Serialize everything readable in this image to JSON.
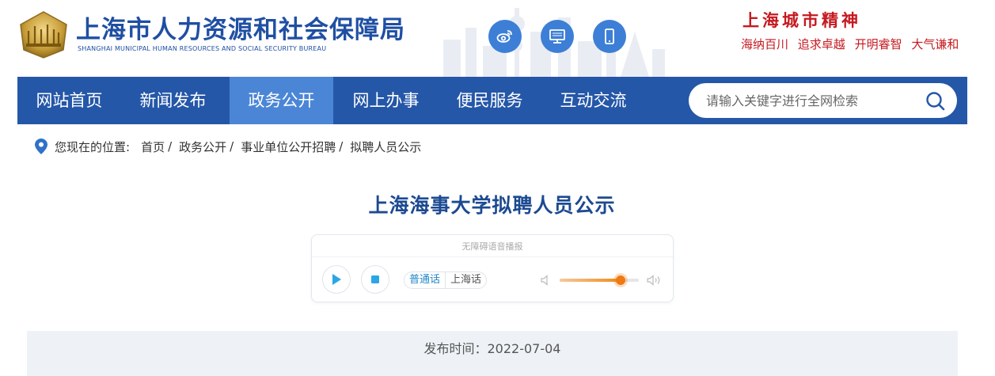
{
  "header": {
    "title_cn": "上海市人力资源和社会保障局",
    "title_en": "SHANGHAI MUNICIPAL HUMAN RESOURCES AND SOCIAL SECURITY BUREAU",
    "social": [
      "weibo-icon",
      "computer-icon",
      "mobile-icon"
    ],
    "spirit_title": "上海城市精神",
    "spirit_words": [
      "海纳百川",
      "追求卓越",
      "开明睿智",
      "大气谦和"
    ]
  },
  "nav": {
    "items": [
      {
        "label": "网站首页"
      },
      {
        "label": "新闻发布"
      },
      {
        "label": "政务公开"
      },
      {
        "label": "网上办事"
      },
      {
        "label": "便民服务"
      },
      {
        "label": "互动交流"
      }
    ],
    "search_placeholder": "请输入关键字进行全网检索"
  },
  "breadcrumb": {
    "prefix": "您现在的位置:",
    "items": [
      "首页",
      "政务公开",
      "事业单位公开招聘",
      "拟聘人员公示"
    ],
    "separator": "/"
  },
  "article": {
    "title": "上海海事大学拟聘人员公示",
    "publish_time": "发布时间：2022-07-04"
  },
  "player": {
    "label": "无障碍语音播报",
    "lang_selected": "普通话",
    "lang_other": "上海话",
    "volume": 0.77
  },
  "colors": {
    "nav_bg": "#2557a8",
    "nav_active": "#4b86d6",
    "title_blue": "#1c4a91",
    "spirit_red": "#c6191f",
    "accent_orange": "#f07a12"
  }
}
